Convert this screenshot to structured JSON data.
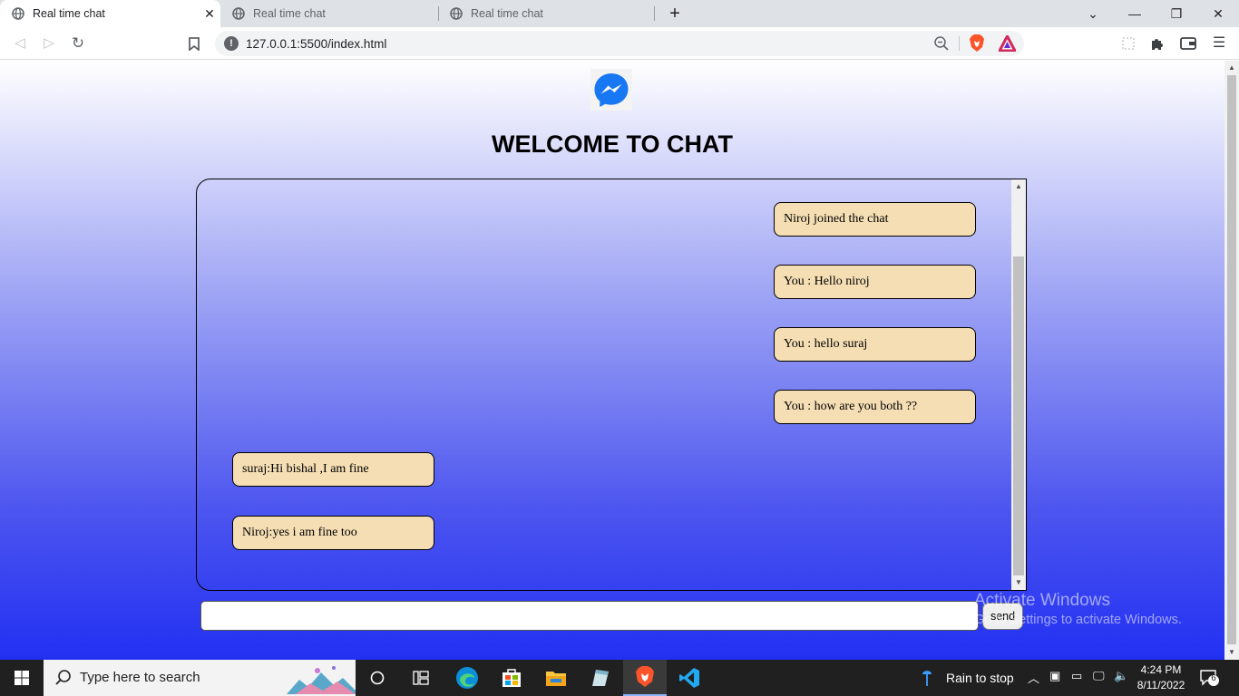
{
  "browser": {
    "tabs": [
      {
        "title": "Real time chat",
        "active": true
      },
      {
        "title": "Real time chat",
        "active": false
      },
      {
        "title": "Real time chat",
        "active": false
      }
    ],
    "url": "127.0.0.1:5500/index.html",
    "icons": {
      "back": "arrow-left-icon",
      "forward": "arrow-right-icon",
      "reload": "reload-icon",
      "bookmark": "bookmark-icon",
      "site_info": "info-icon",
      "zoom": "zoom-out-icon",
      "brave_shields": "brave-lion-icon",
      "brave_rewards": "brave-rewards-icon",
      "extensions": "puzzle-icon",
      "wallet": "wallet-icon",
      "menu": "hamburger-menu-icon"
    }
  },
  "page": {
    "title": "WELCOME TO CHAT",
    "messages": [
      {
        "text": "Niroj joined the chat",
        "side": "right"
      },
      {
        "text": "You : Hello niroj",
        "side": "right"
      },
      {
        "text": "You : hello suraj",
        "side": "right"
      },
      {
        "text": "You : how are you both ??",
        "side": "right"
      },
      {
        "text": "suraj:Hi bishal ,I am fine",
        "side": "left"
      },
      {
        "text": "Niroj:yes i am fine too",
        "side": "left"
      }
    ],
    "input_value": "",
    "send_label": "send",
    "colors": {
      "bubble": "#f5deb3",
      "gradient_top": "#ffffff",
      "gradient_bottom": "#2230f2"
    }
  },
  "watermark": {
    "line1": "Activate Windows",
    "line2": "Go to Settings to activate Windows."
  },
  "taskbar": {
    "search_placeholder": "Type here to search",
    "weather": "Rain to stop",
    "time": "4:24 PM",
    "date": "8/11/2022",
    "notification_count": "6"
  }
}
